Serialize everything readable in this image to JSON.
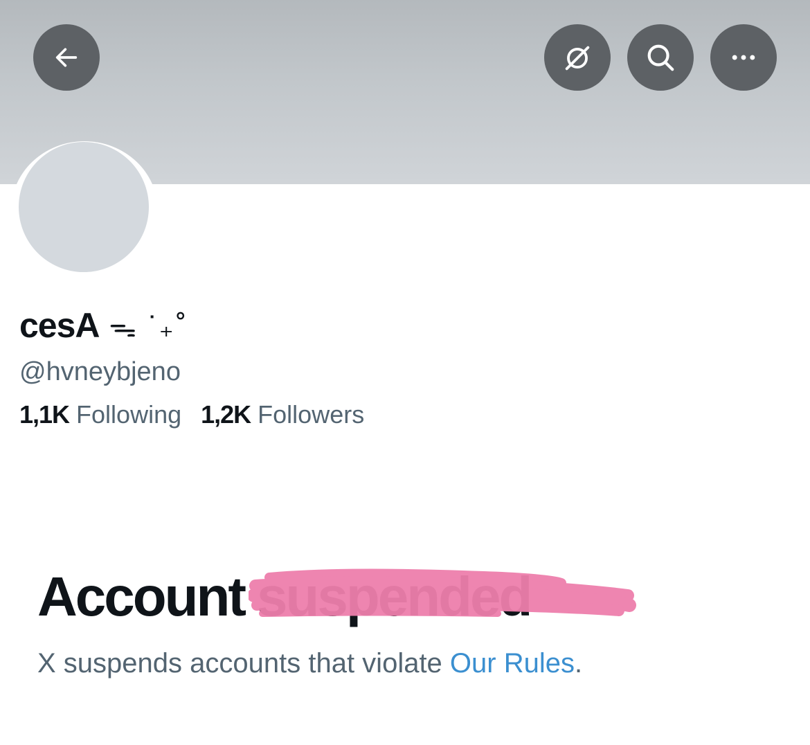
{
  "header": {
    "back_icon": "arrow-left-icon",
    "grok_icon": "grok-icon",
    "search_icon": "search-icon",
    "more_icon": "more-horizontal-icon",
    "banner_color": "#c2c7cb",
    "button_color": "#5d6165"
  },
  "profile": {
    "display_name": "cesA",
    "display_name_decoration": "ᯓ ˙₊˚",
    "handle": "@hvneybjeno",
    "following_count": "1,1K",
    "following_label": "Following",
    "followers_count": "1,2K",
    "followers_label": "Followers"
  },
  "notice": {
    "headline_word": "Account",
    "headline_struck": "suspended",
    "scribble_color": "#ee7fac",
    "description_prefix": "X suspends accounts that violate ",
    "rules_link": "Our Rules",
    "description_suffix": ".",
    "link_color": "#3b8fd0"
  }
}
